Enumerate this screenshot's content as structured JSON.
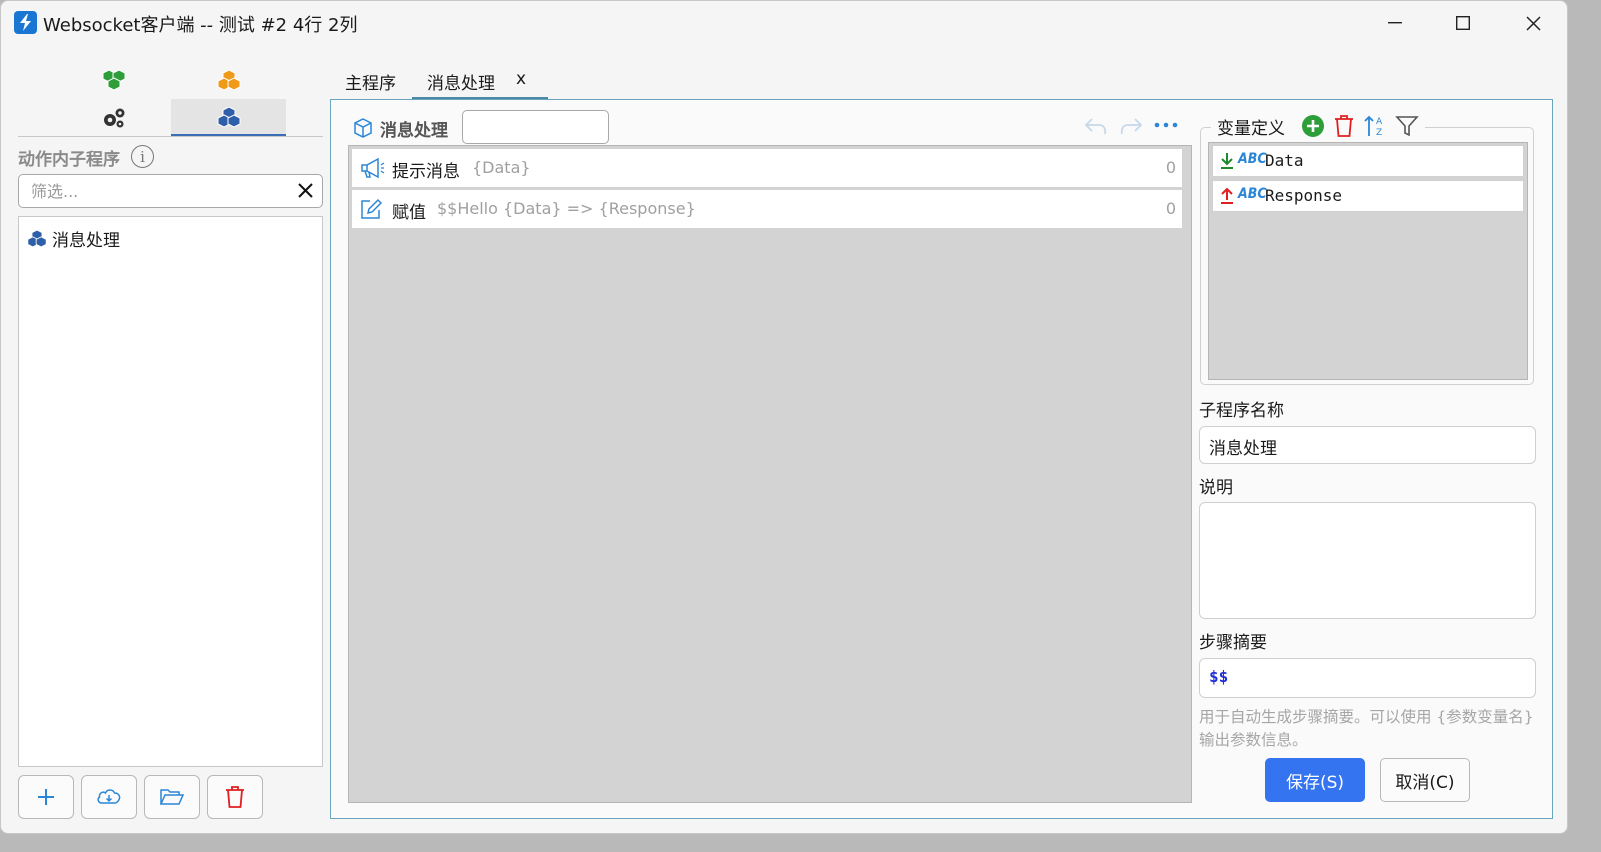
{
  "window": {
    "title": "Websocket客户端 -- 测试 #2 4行 2列",
    "controls": {
      "minimize": "—",
      "maximize": "☐",
      "close": "✕"
    }
  },
  "left_panel": {
    "tabs": [
      {
        "icon": "cubes-green-icon",
        "color": "#2e9e3a"
      },
      {
        "icon": "cubes-orange-icon",
        "color": "#f09a1a"
      },
      {
        "icon": "gears-icon",
        "color": "#333333"
      },
      {
        "icon": "cubes-blue-icon",
        "color": "#2f5fa8",
        "active": true
      }
    ],
    "section_title": "动作内子程序",
    "info_glyph": "i",
    "filter_placeholder": "筛选...",
    "tree_items": [
      {
        "label": "消息处理",
        "icon": "cubes-blue-icon"
      }
    ],
    "toolbar": [
      "add-icon",
      "cloud-download-icon",
      "folder-open-icon",
      "trash-icon"
    ]
  },
  "editor_tabs": [
    {
      "label": "主程序"
    },
    {
      "label": "消息处理",
      "close": "x",
      "active": true
    }
  ],
  "steps": {
    "title": "消息处理",
    "search_value": "",
    "rows": [
      {
        "icon": "megaphone-icon",
        "name": "提示消息",
        "desc": "{Data}",
        "count": "0"
      },
      {
        "icon": "edit-icon",
        "name": "赋值",
        "desc": "$$Hello {Data} => {Response}",
        "count": "0"
      }
    ]
  },
  "variables": {
    "legend": "变量定义",
    "type_label": "ABC",
    "items": [
      {
        "direction": "in",
        "name": "Data",
        "arrow_color": "#1e8a2a"
      },
      {
        "direction": "out",
        "name": "Response",
        "arrow_color": "#e02020"
      }
    ]
  },
  "form": {
    "name_label": "子程序名称",
    "name_value": "消息处理",
    "desc_label": "说明",
    "desc_value": "",
    "summary_label": "步骤摘要",
    "summary_value": "$$",
    "hint": "用于自动生成步骤摘要。可以使用 {参数变量名} 输出参数信息。",
    "save_label": "保存(S)",
    "cancel_label": "取消(C)"
  },
  "colors": {
    "accent": "#3574f0",
    "tab_underline": "#4a8aa6",
    "icon_blue": "#2b86d6"
  }
}
